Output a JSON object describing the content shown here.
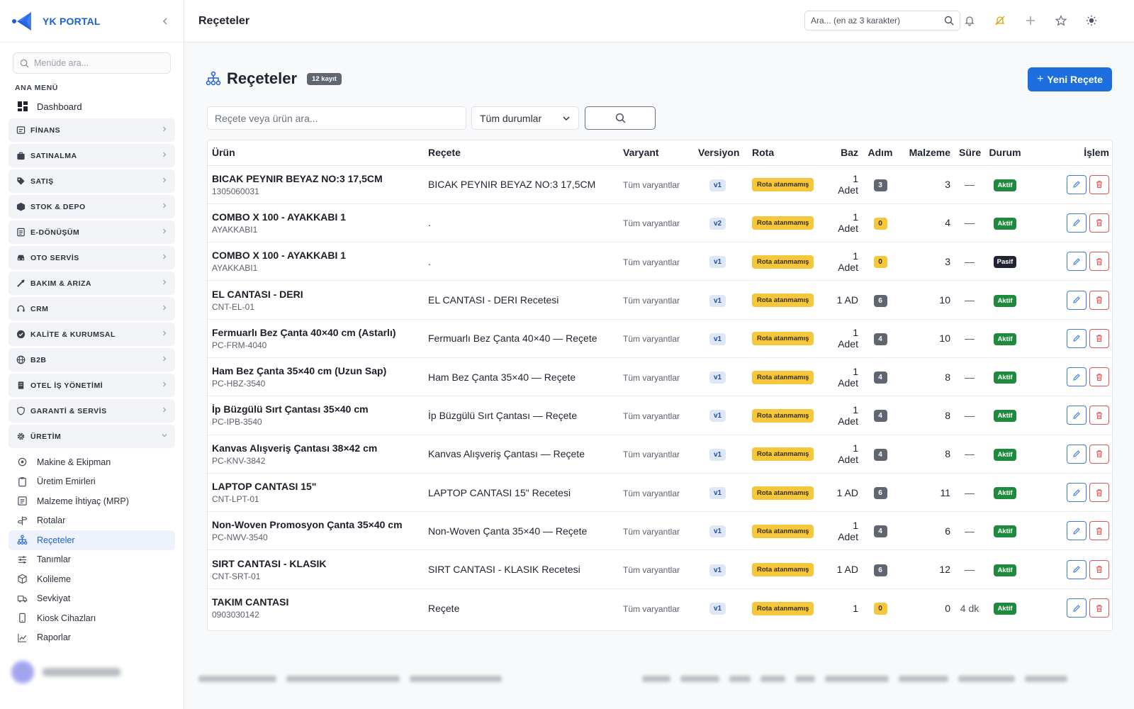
{
  "brand": {
    "name": "YK PORTAL"
  },
  "sidebar": {
    "search_placeholder": "Menüde ara...",
    "section_title": "ANA MENÜ",
    "dashboard": "Dashboard",
    "groups": [
      {
        "label": "FİNANS",
        "icon": "finance-icon"
      },
      {
        "label": "SATINALMA",
        "icon": "bag-icon"
      },
      {
        "label": "SATIŞ",
        "icon": "tag-icon"
      },
      {
        "label": "STOK & DEPO",
        "icon": "box-icon"
      },
      {
        "label": "E-DÖNÜŞÜM",
        "icon": "document-icon"
      },
      {
        "label": "OTO SERVİS",
        "icon": "car-icon"
      },
      {
        "label": "BAKIM & ARIZA",
        "icon": "tools-icon"
      },
      {
        "label": "CRM",
        "icon": "headset-icon"
      },
      {
        "label": "KALİTE & KURUMSAL",
        "icon": "badge-check-icon"
      },
      {
        "label": "B2B",
        "icon": "globe-icon"
      },
      {
        "label": "OTEL İŞ YÖNETİMİ",
        "icon": "building-icon"
      },
      {
        "label": "GARANTİ & SERVİS",
        "icon": "shield-icon"
      },
      {
        "label": "ÜRETİM",
        "icon": "gear-icon"
      }
    ],
    "uretim_items": [
      {
        "label": "Makine & Ekipman",
        "icon": "machine-icon"
      },
      {
        "label": "Üretim Emirleri",
        "icon": "clipboard-icon"
      },
      {
        "label": "Malzeme İhtiyaç (MRP)",
        "icon": "list-icon"
      },
      {
        "label": "Rotalar",
        "icon": "signpost-icon"
      },
      {
        "label": "Reçeteler",
        "icon": "hierarchy-icon",
        "active": true
      },
      {
        "label": "Tanımlar",
        "icon": "sliders-icon"
      },
      {
        "label": "Kolileme",
        "icon": "package-icon"
      },
      {
        "label": "Sevkiyat",
        "icon": "truck-icon"
      },
      {
        "label": "Kiosk Cihazları",
        "icon": "tablet-icon"
      },
      {
        "label": "Raporlar",
        "icon": "chart-icon"
      }
    ]
  },
  "topbar": {
    "title": "Reçeteler",
    "search_placeholder": "Ara... (en az 3 karakter)"
  },
  "page": {
    "title": "Reçeteler",
    "count_badge": "12 kayıt",
    "new_button": "Yeni Reçete",
    "filter_placeholder": "Reçete veya ürün ara...",
    "status_select": "Tüm durumlar"
  },
  "table": {
    "headers": [
      "Ürün",
      "Reçete",
      "Varyant",
      "Versiyon",
      "Rota",
      "Baz",
      "Adım",
      "Malzeme",
      "Süre",
      "Durum",
      "İşlem"
    ],
    "rows": [
      {
        "product": "BICAK PEYNIR BEYAZ NO:3 17,5CM",
        "code": "1305060031",
        "recipe": "BICAK PEYNIR BEYAZ NO:3 17,5CM",
        "variant": "Tüm varyantlar",
        "version": "v1",
        "route": "Rota atanmamış",
        "base": "1 Adet",
        "steps": "3",
        "steps_color": "gray",
        "materials": "3",
        "duration": "—",
        "status": "Aktif"
      },
      {
        "product": "COMBO X 100 - AYAKKABI 1",
        "code": "AYAKKABI1",
        "recipe": ".",
        "variant": "Tüm varyantlar",
        "version": "v2",
        "route": "Rota atanmamış",
        "base": "1 Adet",
        "steps": "0",
        "steps_color": "yellow",
        "materials": "4",
        "duration": "—",
        "status": "Aktif"
      },
      {
        "product": "COMBO X 100 - AYAKKABI 1",
        "code": "AYAKKABI1",
        "recipe": ".",
        "variant": "Tüm varyantlar",
        "version": "v1",
        "route": "Rota atanmamış",
        "base": "1 Adet",
        "steps": "0",
        "steps_color": "yellow",
        "materials": "3",
        "duration": "—",
        "status": "Pasif"
      },
      {
        "product": "EL CANTASI - DERI",
        "code": "CNT-EL-01",
        "recipe": "EL CANTASI - DERI Recetesi",
        "variant": "Tüm varyantlar",
        "version": "v1",
        "route": "Rota atanmamış",
        "base": "1 AD",
        "steps": "6",
        "steps_color": "gray",
        "materials": "10",
        "duration": "—",
        "status": "Aktif"
      },
      {
        "product": "Fermuarlı Bez Çanta 40×40 cm (Astarlı)",
        "code": "PC-FRM-4040",
        "recipe": "Fermuarlı Bez Çanta 40×40 — Reçete",
        "variant": "Tüm varyantlar",
        "version": "v1",
        "route": "Rota atanmamış",
        "base": "1 Adet",
        "steps": "4",
        "steps_color": "gray",
        "materials": "10",
        "duration": "—",
        "status": "Aktif"
      },
      {
        "product": "Ham Bez Çanta 35×40 cm (Uzun Sap)",
        "code": "PC-HBZ-3540",
        "recipe": "Ham Bez Çanta 35×40 — Reçete",
        "variant": "Tüm varyantlar",
        "version": "v1",
        "route": "Rota atanmamış",
        "base": "1 Adet",
        "steps": "4",
        "steps_color": "gray",
        "materials": "8",
        "duration": "—",
        "status": "Aktif"
      },
      {
        "product": "İp Büzgülü Sırt Çantası 35×40 cm",
        "code": "PC-IPB-3540",
        "recipe": "İp Büzgülü Sırt Çantası — Reçete",
        "variant": "Tüm varyantlar",
        "version": "v1",
        "route": "Rota atanmamış",
        "base": "1 Adet",
        "steps": "4",
        "steps_color": "gray",
        "materials": "8",
        "duration": "—",
        "status": "Aktif"
      },
      {
        "product": "Kanvas Alışveriş Çantası 38×42 cm",
        "code": "PC-KNV-3842",
        "recipe": "Kanvas Alışveriş Çantası — Reçete",
        "variant": "Tüm varyantlar",
        "version": "v1",
        "route": "Rota atanmamış",
        "base": "1 Adet",
        "steps": "4",
        "steps_color": "gray",
        "materials": "8",
        "duration": "—",
        "status": "Aktif"
      },
      {
        "product": "LAPTOP CANTASI 15\"",
        "code": "CNT-LPT-01",
        "recipe": "LAPTOP CANTASI 15\" Recetesi",
        "variant": "Tüm varyantlar",
        "version": "v1",
        "route": "Rota atanmamış",
        "base": "1 AD",
        "steps": "6",
        "steps_color": "gray",
        "materials": "11",
        "duration": "—",
        "status": "Aktif"
      },
      {
        "product": "Non-Woven Promosyon Çanta 35×40 cm",
        "code": "PC-NWV-3540",
        "recipe": "Non-Woven Çanta 35×40 — Reçete",
        "variant": "Tüm varyantlar",
        "version": "v1",
        "route": "Rota atanmamış",
        "base": "1 Adet",
        "steps": "4",
        "steps_color": "gray",
        "materials": "6",
        "duration": "—",
        "status": "Aktif"
      },
      {
        "product": "SIRT CANTASI - KLASIK",
        "code": "CNT-SRT-01",
        "recipe": "SIRT CANTASI - KLASIK Recetesi",
        "variant": "Tüm varyantlar",
        "version": "v1",
        "route": "Rota atanmamış",
        "base": "1 AD",
        "steps": "6",
        "steps_color": "gray",
        "materials": "12",
        "duration": "—",
        "status": "Aktif"
      },
      {
        "product": "TAKIM CANTASI",
        "code": "0903030142",
        "recipe": "Reçete",
        "variant": "Tüm varyantlar",
        "version": "v1",
        "route": "Rota atanmamış",
        "base": "1",
        "steps": "0",
        "steps_color": "yellow",
        "materials": "0",
        "duration": "4 dk",
        "status": "Aktif"
      }
    ]
  }
}
